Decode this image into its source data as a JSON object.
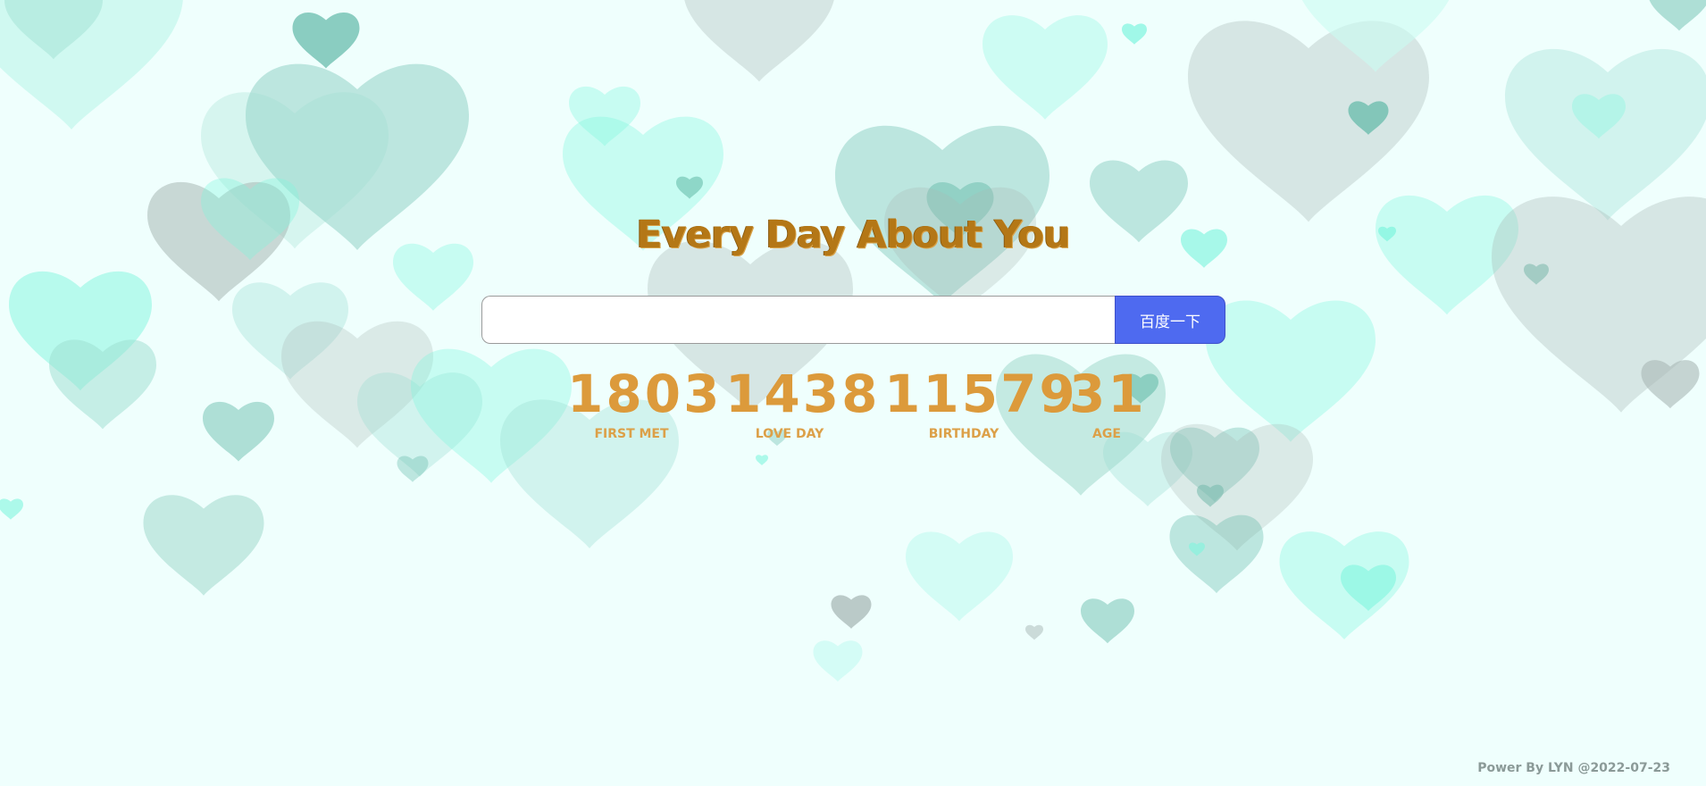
{
  "page": {
    "title": "Every Day About You",
    "footer": "Power By LYN @2022-07-23"
  },
  "search": {
    "input_value": "",
    "button_label": "百度一下"
  },
  "counters": [
    {
      "value": "1803",
      "label": "FIRST MET"
    },
    {
      "value": "1438",
      "label": "LOVE DAY"
    },
    {
      "value": "11579",
      "label": "BIRTHDAY"
    },
    {
      "value": "31",
      "label": "AGE"
    }
  ],
  "colors": {
    "background": "#effffd",
    "title": "#b47716",
    "counter": "#dc9a3b",
    "button": "#4e6af0",
    "hearts": [
      "#5fb8a6",
      "#9bded0",
      "#7ff5de",
      "#b6f4e8",
      "#a8b8b5",
      "#c9fbf2"
    ]
  },
  "icons": {
    "decoration": "heart-icon"
  }
}
